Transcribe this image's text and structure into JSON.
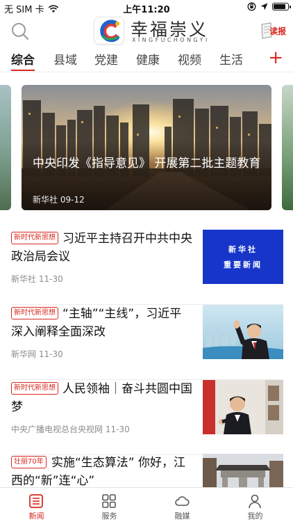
{
  "status_bar": {
    "carrier": "无 SIM 卡",
    "time": "上午11:20"
  },
  "header": {
    "brand_name": "幸福崇义",
    "brand_pinyin": "XINGFUCHONGYI",
    "read_label": "读报",
    "search_icon": "search-icon"
  },
  "tabs": [
    {
      "label": "综合",
      "active": true
    },
    {
      "label": "县域"
    },
    {
      "label": "党建"
    },
    {
      "label": "健康"
    },
    {
      "label": "视频"
    },
    {
      "label": "生活"
    }
  ],
  "tab_add_label": "+",
  "carousel": {
    "title": "中央印发《指导意见》 开展第二批主题教育",
    "source": "新华社",
    "date": "09-12"
  },
  "news": [
    {
      "tag": "新时代新思想",
      "title": "习近平主持召开中共中央政治局会议",
      "source": "新华社",
      "date": "11-30",
      "thumb_line1": "新华社",
      "thumb_line2": "重要新闻"
    },
    {
      "tag": "新时代新思想",
      "title": "“主轴”“主线”，习近平深入阐释全面深改",
      "source": "新华网",
      "date": "11-30"
    },
    {
      "tag": "新时代新思想",
      "title": "人民领袖｜奋斗共圆中国梦",
      "source": "中央广播电视总台央视网",
      "date": "11-30"
    },
    {
      "tag": "壮丽70年",
      "title": "实施“生态算法” 你好，江西的“新”连“心”",
      "source": "",
      "date": ""
    }
  ],
  "bottom_nav": [
    {
      "label": "新闻",
      "icon": "news-list-icon",
      "active": true
    },
    {
      "label": "服务",
      "icon": "grid-icon"
    },
    {
      "label": "融媒",
      "icon": "cloud-icon"
    },
    {
      "label": "我的",
      "icon": "user-icon"
    }
  ],
  "colors": {
    "accent": "#d8281f",
    "thumb_blue": "#1736c9"
  }
}
